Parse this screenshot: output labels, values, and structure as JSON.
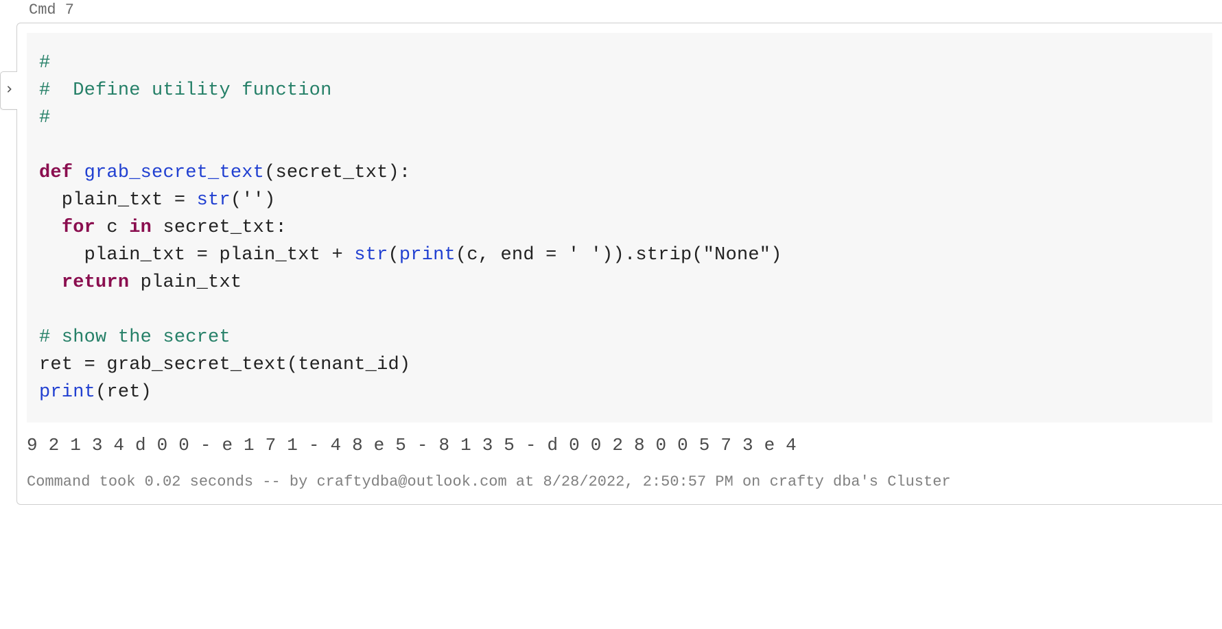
{
  "cell": {
    "label": "Cmd 7",
    "code": {
      "line1": "#",
      "line2": "#  Define utility function",
      "line3": "#",
      "blank1": "",
      "def_kw": "def",
      "def_name": "grab_secret_text",
      "def_sig_rest": "(secret_txt):",
      "l_assign_lhs": "  plain_txt = ",
      "l_assign_str": "str",
      "l_assign_rest": "('')",
      "for_indent": "  ",
      "for_kw": "for",
      "for_mid": " c ",
      "in_kw": "in",
      "for_rest": " secret_txt:",
      "body_indent": "    plain_txt = plain_txt + ",
      "body_str": "str",
      "body_paren_open": "(",
      "body_print": "print",
      "body_after_print": "(c, end = ' ')).strip(\"None\")",
      "return_indent": "  ",
      "return_kw": "return",
      "return_rest": " plain_txt",
      "blank2": "",
      "comment_show": "# show the secret",
      "call_line": "ret = grab_secret_text(tenant_id)",
      "print_builtin": "print",
      "print_rest": "(ret)"
    },
    "output": "9 2 1 3 4 d 0 0 - e 1 7 1 - 4 8 e 5 - 8 1 3 5 - d 0 0 2 8 0 0 5 7 3 e 4 ",
    "status": "Command took 0.02 seconds -- by craftydba@outlook.com at 8/28/2022, 2:50:57 PM on crafty dba's Cluster"
  }
}
